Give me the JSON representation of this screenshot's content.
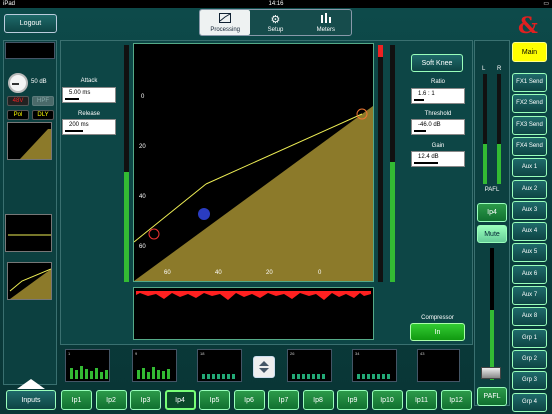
{
  "status": {
    "device": "iPad",
    "time": "14:16"
  },
  "header": {
    "logout_label": "Logout",
    "tabs": [
      {
        "label": "Processing",
        "icon": "processing-icon",
        "active": true
      },
      {
        "label": "Setup",
        "icon": "gear-icon",
        "active": false
      },
      {
        "label": "Meters",
        "icon": "meters-icon",
        "active": false
      }
    ],
    "logo": "&"
  },
  "left_strip": {
    "gain_value": "50 dB",
    "phantom_label": "48V",
    "hpf_label": "HPF",
    "polarity_label": "Pol",
    "delay_label": "DLY",
    "inputs_label": "Inputs"
  },
  "compressor": {
    "attack_label": "Attack",
    "attack_value": "5.00 ms",
    "release_label": "Release",
    "release_value": "200 ms",
    "soft_knee_label": "Soft Knee",
    "ratio_label": "Ratio",
    "ratio_value": "1.6 : 1",
    "threshold_label": "Threshold",
    "threshold_value": "-46.0 dB",
    "gain_label": "Gain",
    "gain_value": "12.4 dB",
    "compressor_label": "Compressor",
    "in_label": "In",
    "graph_y_ticks": [
      "0",
      "20",
      "40",
      "60"
    ],
    "graph_x_ticks": [
      "60",
      "40",
      "20",
      "0"
    ]
  },
  "meter_bridge": {
    "groups": [
      {
        "labels": [
          "1",
          "2",
          "3",
          "4",
          "5",
          "6",
          "7",
          "8"
        ]
      },
      {
        "labels": [
          "9",
          "10",
          "11",
          "12",
          "13",
          "14",
          "15",
          "16",
          "17"
        ]
      },
      {
        "labels": [
          "18",
          "19",
          "20",
          "21",
          "22",
          "23",
          "24",
          "25"
        ]
      },
      {
        "labels": [
          "26",
          "27",
          "28",
          "29",
          "30",
          "31",
          "32",
          "33"
        ]
      },
      {
        "labels": [
          "34",
          "35",
          "36",
          "37",
          "38",
          "39",
          "40",
          "41",
          "42"
        ]
      },
      {
        "labels": [
          "43",
          "44",
          "45",
          "46",
          "47"
        ]
      }
    ]
  },
  "channel_select": [
    "Ip1",
    "Ip2",
    "Ip3",
    "Ip4",
    "Ip5",
    "Ip6",
    "Ip7",
    "Ip8",
    "Ip9",
    "Ip10",
    "Ip11",
    "Ip12"
  ],
  "active_channel": "Ip4",
  "right": {
    "main_label": "Main",
    "mixes": [
      "FX1 Send",
      "FX2 Send",
      "FX3 Send",
      "FX4 Send",
      "Aux 1",
      "Aux 2",
      "Aux 3",
      "Aux 4",
      "Aux 5",
      "Aux 6",
      "Aux 7",
      "Aux 8",
      "Grp 1",
      "Grp 2",
      "Grp 3",
      "Grp 4"
    ],
    "lr_labels": [
      "L",
      "R"
    ],
    "pafl_meter_label": "PAFL",
    "channel_label": "Ip4",
    "mute_label": "Mute",
    "pafl_label": "PAFL"
  },
  "colors": {
    "accent_green": "#2c9a4a",
    "main_yellow": "#ffff00",
    "meter_red": "#ff2020",
    "graph_fill": "#8c7a2a"
  }
}
